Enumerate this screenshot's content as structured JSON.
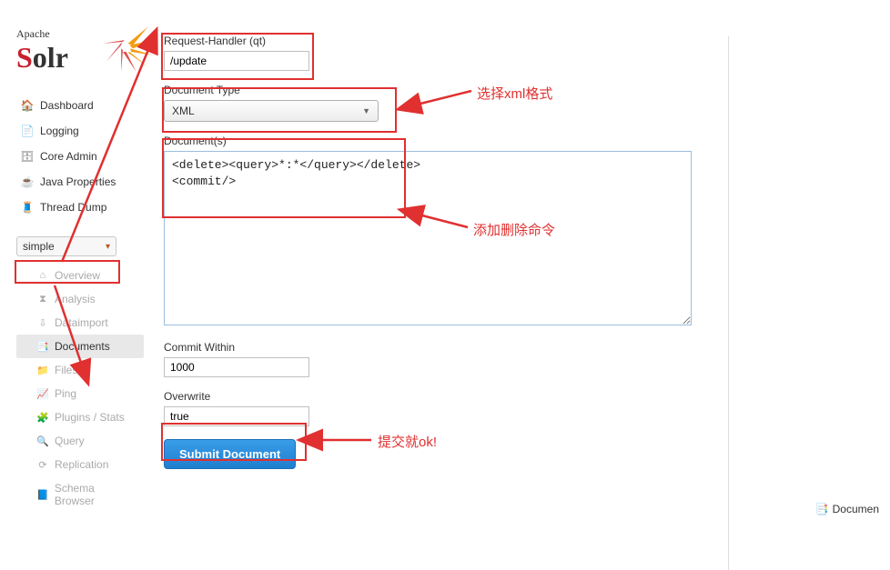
{
  "logo": {
    "apache": "Apache",
    "solr_s": "S",
    "solr_olr": "olr"
  },
  "nav": {
    "dashboard": "Dashboard",
    "logging": "Logging",
    "core_admin": "Core Admin",
    "java_properties": "Java Properties",
    "thread_dump": "Thread Dump"
  },
  "core_select": {
    "value": "simple"
  },
  "subnav": {
    "overview": "Overview",
    "analysis": "Analysis",
    "dataimport": "Dataimport",
    "documents": "Documents",
    "files": "Files",
    "ping": "Ping",
    "plugins_stats": "Plugins / Stats",
    "query": "Query",
    "replication": "Replication",
    "schema_browser": "Schema Browser"
  },
  "form": {
    "qt_label": "Request-Handler (qt)",
    "qt_value": "/update",
    "doc_type_label": "Document Type",
    "doc_type_value": "XML",
    "documents_label": "Document(s)",
    "documents_value": "<delete><query>*:*</query></delete>\n<commit/>",
    "commit_within_label": "Commit Within",
    "commit_within_value": "1000",
    "overwrite_label": "Overwrite",
    "overwrite_value": "true",
    "submit_label": "Submit Document"
  },
  "right": {
    "documents_link": "Documen"
  },
  "annotations": {
    "select_xml": "选择xml格式",
    "add_delete_cmd": "添加删除命令",
    "submit_ok": "提交就ok!"
  }
}
